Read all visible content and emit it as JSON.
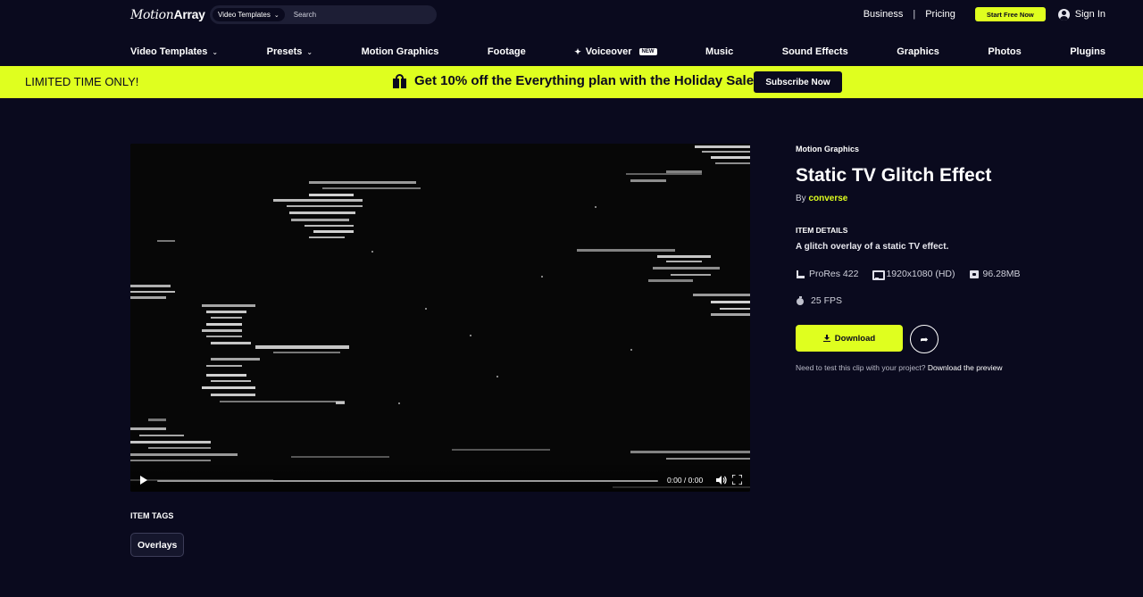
{
  "header": {
    "logo_part1": "Motion",
    "logo_part2": "Array",
    "search_type": "Video Templates",
    "search_placeholder": "Search",
    "business": "Business",
    "separator": "|",
    "pricing": "Pricing",
    "start_free": "Start Free Now",
    "sign_in": "Sign In"
  },
  "nav": {
    "video_templates": "Video Templates",
    "presets": "Presets",
    "motion_graphics": "Motion Graphics",
    "footage": "Footage",
    "voiceover": "Voiceover",
    "new_badge": "NEW",
    "music": "Music",
    "sound_effects": "Sound Effects",
    "graphics": "Graphics",
    "photos": "Photos",
    "plugins": "Plugins"
  },
  "promo": {
    "left": "LIMITED TIME ONLY!",
    "headline": "Get 10% off the Everything plan with the Holiday Sale",
    "button": "Subscribe Now"
  },
  "player": {
    "timecode": "0:00 / 0:00",
    "progress": 0
  },
  "tags": {
    "title": "ITEM TAGS",
    "items": [
      "Overlays"
    ]
  },
  "item": {
    "category": "Motion Graphics",
    "title": "Static TV Glitch Effect",
    "by": "By",
    "author": "converse",
    "details_title": "ITEM DETAILS",
    "description": "A glitch overlay of a static TV effect.",
    "codec": "ProRes 422",
    "resolution": "1920x1080 (HD)",
    "file_size": "96.28MB",
    "fps": "25 FPS",
    "download": "Download",
    "preview_prefix": "Need to test this clip with your project?",
    "preview_link": "Download the preview"
  },
  "colors": {
    "background": "#0a0a1e",
    "accent": "#dfff1f"
  }
}
